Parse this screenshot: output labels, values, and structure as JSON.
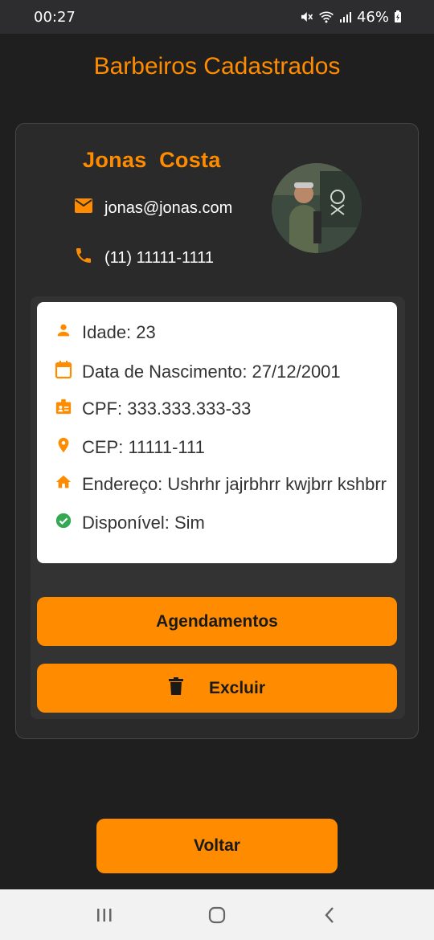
{
  "status_bar": {
    "time": "00:27",
    "battery": "46%"
  },
  "header": {
    "title": "Barbeiros Cadastrados"
  },
  "barber": {
    "name": "Jonas  Costa",
    "email": "jonas@jonas.com",
    "phone": "(11) 11111-1111"
  },
  "details": {
    "idade": "Idade: 23",
    "nascimento": "Data de Nascimento: 27/12/2001",
    "cpf": "CPF: 333.333.333-33",
    "cep": "CEP: 11111-111",
    "endereco": "Endereço: Ushrhr jajrbhrr kwjbrr kshbrr",
    "disponivel": "Disponível: Sim"
  },
  "buttons": {
    "agendamentos": "Agendamentos",
    "excluir": "Excluir",
    "voltar": "Voltar"
  },
  "colors": {
    "accent": "#ff8c00",
    "background": "#1f1f1f",
    "card": "#2a2a2a",
    "success": "#34a853"
  },
  "icons": {
    "email": "mail-icon",
    "phone": "phone-icon",
    "idade": "person-icon",
    "nascimento": "calendar-icon",
    "cpf": "id-badge-icon",
    "cep": "location-pin-icon",
    "endereco": "home-icon",
    "disponivel": "check-circle-icon",
    "excluir": "trash-icon"
  }
}
